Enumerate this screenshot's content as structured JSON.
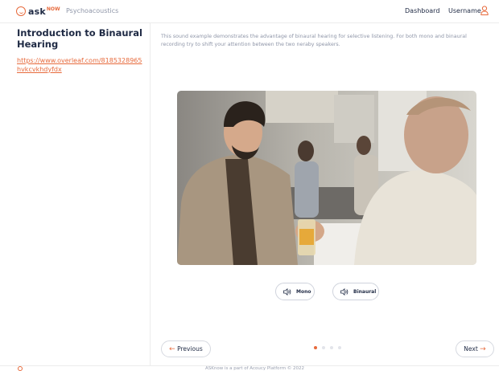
{
  "header": {
    "logo_text_main": "ask",
    "logo_text_now": "NOW",
    "section": "Psychoacoustics",
    "nav_dashboard": "Dashboard",
    "nav_username": "Username"
  },
  "sidebar": {
    "title": "Introduction to Binaural Hearing",
    "link": "https://www.overleaf.com/8185328965hvkcvkhdyfdx"
  },
  "main": {
    "description": "This sound example demonstrates the advantage of binaural hearing for selective listening. For both mono and binaural recording try to shift your attention between the two neraby speakers.",
    "buttons": {
      "mono": "Mono",
      "binaural": "Binaural"
    },
    "nav": {
      "previous": "Previous",
      "next": "Next",
      "pages_total": 4,
      "page_current": 1
    }
  },
  "footer": {
    "text": "ASKnow is a part of Acoucy Platform © 2022"
  },
  "colors": {
    "accent": "#e76a3c",
    "text": "#1f2a44",
    "muted": "#8f96a8"
  }
}
